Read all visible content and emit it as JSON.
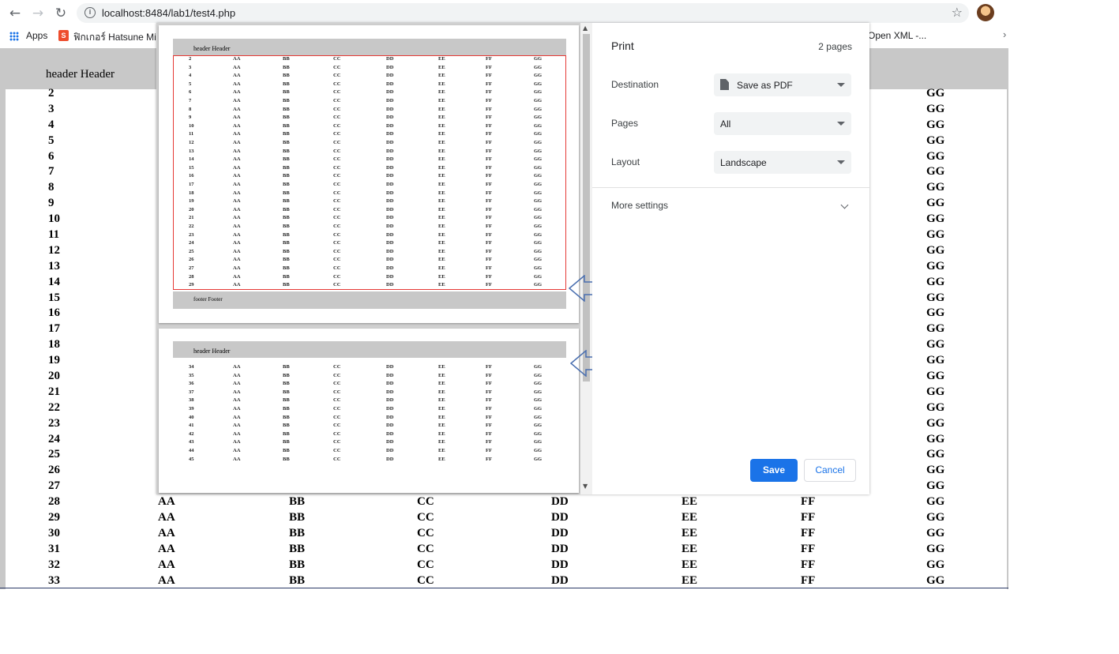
{
  "browser": {
    "url": "localhost:8484/lab1/test4.php",
    "back_glyph": "←",
    "forward_glyph": "→",
    "reload_glyph": "↻",
    "star_glyph": "☆",
    "bookmarks": {
      "apps": "Apps",
      "item1_icon_text": "S",
      "item1": "ฟิกเกอร์ Hatsune Mi...",
      "item2": "Open XML -...",
      "more_glyph": "›"
    }
  },
  "page": {
    "header_text": "header Header",
    "rows": [
      [
        "2",
        "",
        "",
        "",
        "",
        "",
        "",
        "GG"
      ],
      [
        "3",
        "",
        "",
        "",
        "",
        "",
        "",
        "GG"
      ],
      [
        "4",
        "",
        "",
        "",
        "",
        "",
        "",
        "GG"
      ],
      [
        "5",
        "",
        "",
        "",
        "",
        "",
        "",
        "GG"
      ],
      [
        "6",
        "",
        "",
        "",
        "",
        "",
        "",
        "GG"
      ],
      [
        "7",
        "",
        "",
        "",
        "",
        "",
        "",
        "GG"
      ],
      [
        "8",
        "",
        "",
        "",
        "",
        "",
        "",
        "GG"
      ],
      [
        "9",
        "",
        "",
        "",
        "",
        "",
        "",
        "GG"
      ],
      [
        "10",
        "",
        "",
        "",
        "",
        "",
        "",
        "GG"
      ],
      [
        "11",
        "",
        "",
        "",
        "",
        "",
        "",
        "GG"
      ],
      [
        "12",
        "",
        "",
        "",
        "",
        "",
        "",
        "GG"
      ],
      [
        "13",
        "",
        "",
        "",
        "",
        "",
        "",
        "GG"
      ],
      [
        "14",
        "",
        "",
        "",
        "",
        "",
        "",
        "GG"
      ],
      [
        "15",
        "",
        "",
        "",
        "",
        "",
        "",
        "GG"
      ],
      [
        "16",
        "",
        "",
        "",
        "",
        "",
        "",
        "GG"
      ],
      [
        "17",
        "",
        "",
        "",
        "",
        "",
        "",
        "GG"
      ],
      [
        "18",
        "",
        "",
        "",
        "",
        "",
        "",
        "GG"
      ],
      [
        "19",
        "",
        "",
        "",
        "",
        "",
        "",
        "GG"
      ],
      [
        "20",
        "",
        "",
        "",
        "",
        "",
        "",
        "GG"
      ],
      [
        "21",
        "",
        "",
        "",
        "",
        "",
        "",
        "GG"
      ],
      [
        "22",
        "",
        "",
        "",
        "",
        "",
        "",
        "GG"
      ],
      [
        "23",
        "",
        "",
        "",
        "",
        "",
        "",
        "GG"
      ],
      [
        "24",
        "",
        "",
        "",
        "",
        "",
        "",
        "GG"
      ],
      [
        "25",
        "",
        "",
        "",
        "",
        "",
        "",
        "GG"
      ],
      [
        "26",
        "",
        "",
        "",
        "",
        "",
        "",
        "GG"
      ],
      [
        "27",
        "",
        "",
        "",
        "",
        "",
        "",
        "GG"
      ],
      [
        "28",
        "AA",
        "BB",
        "CC",
        "DD",
        "EE",
        "FF",
        "GG"
      ],
      [
        "29",
        "AA",
        "BB",
        "CC",
        "DD",
        "EE",
        "FF",
        "GG"
      ],
      [
        "30",
        "AA",
        "BB",
        "CC",
        "DD",
        "EE",
        "FF",
        "GG"
      ],
      [
        "31",
        "AA",
        "BB",
        "CC",
        "DD",
        "EE",
        "FF",
        "GG"
      ],
      [
        "32",
        "AA",
        "BB",
        "CC",
        "DD",
        "EE",
        "FF",
        "GG"
      ],
      [
        "33",
        "AA",
        "BB",
        "CC",
        "DD",
        "EE",
        "FF",
        "GG"
      ]
    ]
  },
  "print_dialog": {
    "title": "Print",
    "page_count": "2 pages",
    "destination_label": "Destination",
    "destination_value": "Save as PDF",
    "pages_label": "Pages",
    "pages_value": "All",
    "layout_label": "Layout",
    "layout_value": "Landscape",
    "more_settings": "More settings",
    "save": "Save",
    "cancel": "Cancel",
    "preview": {
      "sheet1_header": "header Header",
      "sheet1_footer": "footer Footer",
      "sheet1_rows": [
        "2",
        "3",
        "4",
        "5",
        "6",
        "7",
        "8",
        "9",
        "10",
        "11",
        "12",
        "13",
        "14",
        "15",
        "16",
        "17",
        "18",
        "19",
        "20",
        "21",
        "22",
        "23",
        "24",
        "25",
        "26",
        "27",
        "28",
        "29"
      ],
      "sheet2_header": "header Header",
      "sheet2_rows": [
        "34",
        "35",
        "36",
        "37",
        "38",
        "39",
        "40",
        "41",
        "42",
        "43",
        "44",
        "45"
      ],
      "cells": [
        "AA",
        "BB",
        "CC",
        "DD",
        "EE",
        "FF",
        "GG"
      ],
      "scroll_up": "▲",
      "scroll_down": "▼"
    }
  }
}
